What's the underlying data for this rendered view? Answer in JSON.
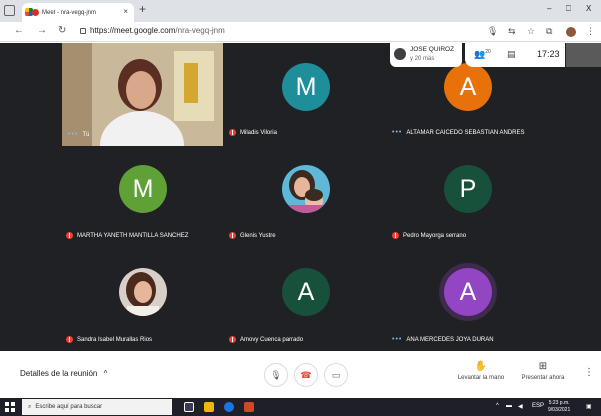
{
  "browser": {
    "tab_title": "Meet - nra-vegq-jnm",
    "tab_close": "×",
    "new_tab": "+",
    "url_host": "https://meet.google.com",
    "url_path": "/nra-vegq-jnm",
    "window_min": "–",
    "window_max": "⎕",
    "window_close": "X"
  },
  "overlay": {
    "presenter_name": "JOSE QUIROZ",
    "presenter_more": "y 20 más",
    "people_count": "20",
    "time": "17:23"
  },
  "participants": [
    {
      "name": "Tú",
      "status": "speaking"
    },
    {
      "name": "Miladis Viloria",
      "initial": "M",
      "color": "#1e8e9a",
      "status": "muted"
    },
    {
      "name": "ALTAMAR CAICEDO SEBASTIAN ANDRES",
      "initial": "A",
      "color": "#e8710a",
      "status": "speaking"
    },
    {
      "name": "MARTHA YANETH MANTILLA SANCHEZ",
      "initial": "M",
      "color": "#5fa037",
      "status": "muted"
    },
    {
      "name": "Glenis Yustre",
      "status": "muted"
    },
    {
      "name": "Pedro Mayorga serrano",
      "initial": "P",
      "color": "#17503b",
      "status": "muted"
    },
    {
      "name": "Sandra Isabel Murallas Rios",
      "status": "muted"
    },
    {
      "name": "Amovy Cuenca parrado",
      "initial": "A",
      "color": "#17503b",
      "status": "muted"
    },
    {
      "name": "ANA MERCEDES JOYA DURAN",
      "initial": "A",
      "color": "#9346c4",
      "status": "speaking"
    }
  ],
  "meetbar": {
    "details_label": "Detalles de la reunión",
    "raise_hand_label": "Levantar la mano",
    "present_label": "Presentar ahora"
  },
  "taskbar": {
    "search_placeholder": "Escribe aquí para buscar",
    "lang": "ESP",
    "time": "5:23 p.m.",
    "date": "9/03/2021"
  }
}
